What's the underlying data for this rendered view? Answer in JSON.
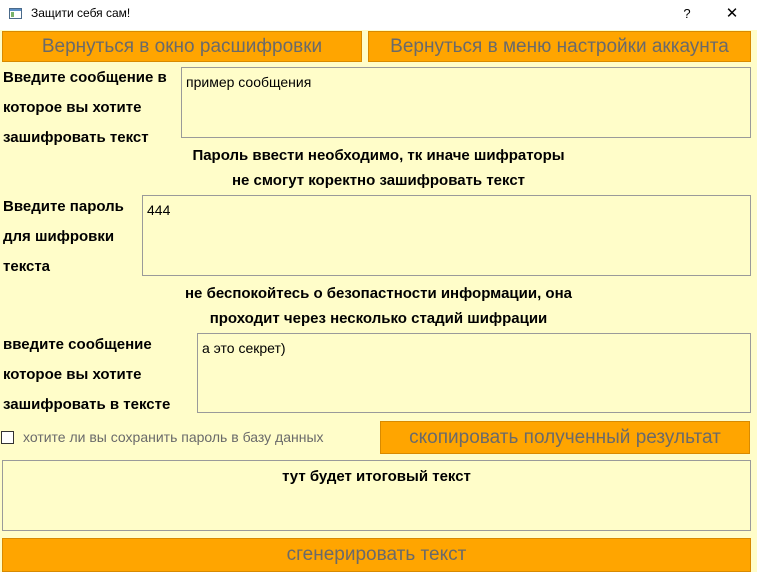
{
  "window": {
    "title": "Защити себя сам!",
    "help_label": "?",
    "close_label": "✕"
  },
  "toolbar": {
    "back_to_decrypt": "Вернуться в окно расшифровки",
    "back_to_settings": "Вернуться в меню настройки аккаунта"
  },
  "message": {
    "label": "Введите сообщение в которое вы хотите зашифровать текст",
    "value": "пример сообщения"
  },
  "password_note": {
    "line1": "Пароль ввести необходимо, тк иначе шифраторы",
    "line2": "не смогут коректно зашифровать текст"
  },
  "password": {
    "label": "Введите пароль для шифровки текста",
    "value": "444"
  },
  "security_note": {
    "line1": "не беспокойтесь о безопастности информации, она",
    "line2": "проходит через несколько стадий шифрации"
  },
  "hidden_text": {
    "label": "введите сообщение которое вы хотите зашифровать в тексте",
    "value": "а это секрет)"
  },
  "save_password": {
    "label": "хотите ли вы сохранить пароль в базу данных",
    "checked": false
  },
  "copy_button": "скопировать полученный результат",
  "result": {
    "text": "тут будет итоговый текст"
  },
  "generate_button": "сгенерировать текст",
  "colors": {
    "background": "#fffdc9",
    "button": "#ffa500",
    "button_text": "#6a6a6a"
  }
}
